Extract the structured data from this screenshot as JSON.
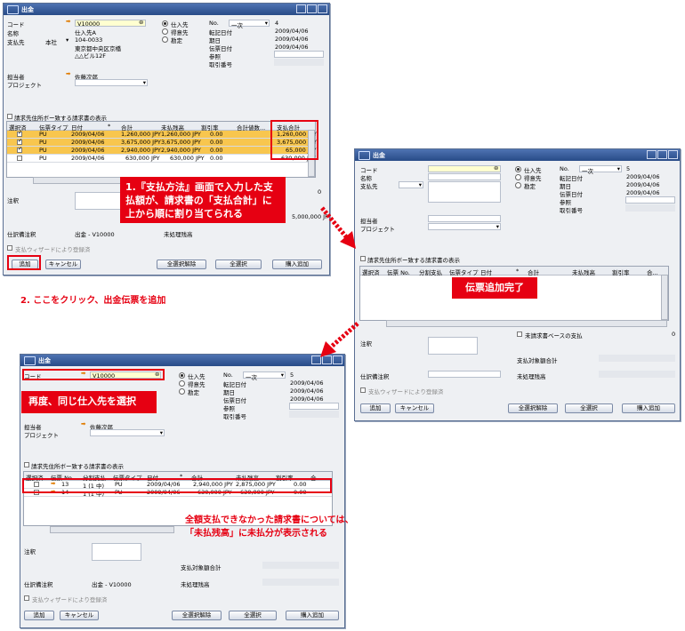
{
  "window_title": "出金",
  "header": {
    "code_label": "コード",
    "name_label": "名称",
    "payee_label": "支払先",
    "payee_sel": "本社",
    "contact_label": "担当者",
    "project_label": "プロジェクト",
    "code_value": "V10000",
    "name_value": "仕入先A",
    "addr1": "104-0033",
    "addr2": "東京都中央区京橋",
    "addr3": "△△ビル12F",
    "contact_value": "佐藤次郎"
  },
  "radio": {
    "vendor": "仕入先",
    "customer": "得意先",
    "account": "勘定"
  },
  "right": {
    "no_label": "No.",
    "no_series": "一次",
    "no1": "4",
    "no3": "5",
    "posting_date_label": "転記日付",
    "due_date_label": "期日",
    "doc_date_label": "伝票日付",
    "reference_label": "参照",
    "trans_no_label": "取引番号",
    "date_value": "2009/04/06"
  },
  "grid_section": {
    "checkbox_label": "請求先住所ボー致する請求書の表示"
  },
  "grid1": {
    "columns": [
      "選択済",
      "伝票タイプ",
      "日付",
      "*",
      "合計",
      "未払残高",
      "割引率",
      "合計値数...",
      "支払合計"
    ],
    "rows": [
      {
        "type": "PU",
        "date": "2009/04/06",
        "total": "1,260,000 JPY",
        "balance": "1,260,000 JPY",
        "disc": "0.00",
        "pay": "1,260,000 JPY"
      },
      {
        "type": "PU",
        "date": "2009/04/06",
        "total": "3,675,000 JPY",
        "balance": "3,675,000 JPY",
        "disc": "0.00",
        "pay": "3,675,000 JPY"
      },
      {
        "type": "PU",
        "date": "2009/04/06",
        "total": "2,940,000 JPY",
        "balance": "2,940,000 JPY",
        "disc": "0.00",
        "pay": "65,000 JPY"
      },
      {
        "type": "PU",
        "date": "2009/04/06",
        "total": "630,000 JPY",
        "balance": "630,000 JPY",
        "disc": "0.00",
        "pay": "630,000 JPY"
      }
    ]
  },
  "grid2_columns": [
    "選択済",
    "伝票 No.",
    "分割支払",
    "伝票タイプ",
    "日付",
    "*",
    "合計",
    "未払残高",
    "割引率",
    "合..."
  ],
  "grid3": {
    "columns": [
      "選択済",
      "伝票 No.",
      "分割支払",
      "伝票タイプ",
      "日付",
      "*",
      "合計",
      "未払残高",
      "割引率",
      "合..."
    ],
    "rows": [
      {
        "no": "13",
        "split": "1 (1 中)",
        "type": "PU",
        "date": "2009/04/06",
        "total": "2,940,000 JPY",
        "balance": "2,875,000 JPY",
        "disc": "0.00"
      },
      {
        "no": "14",
        "split": "1 (1 中)",
        "type": "PU",
        "date": "2009/04/06",
        "total": "630,000 JPY",
        "balance": "630,000 JPY",
        "disc": "0.00"
      }
    ]
  },
  "bottom": {
    "remarks_label": "注釈",
    "journal_label": "仕訳備注釈",
    "journal_value": "出金 - V10000",
    "payable_total_label": "支払対象額合計",
    "unassigned_label": "未処理残高",
    "pay_wizard_label": "支払ウィザードにより登録済",
    "amount_value": "5,000,000 JPY",
    "zero_value": "0",
    "base_invoice_label": "未請求書ベースの支払"
  },
  "buttons": {
    "add": "追加",
    "cancel": "キャンセル",
    "deselect_all": "全選択解除",
    "select_all": "全選択",
    "payment_means": "購入追加"
  },
  "annotations": {
    "note1_line1": "1.『支払方法』画面で入力した支",
    "note1_line2": "払額が、請求書の「支払合計」に",
    "note1_line3": "上から順に割り当てられる",
    "note2": "2. ここをクリック、出金伝票を追加",
    "note3": "伝票追加完了",
    "note4": "再度、同じ仕入先を選択",
    "note5_line1": "全額支払できなかった請求書については、",
    "note5_line2": "「未払残高」に未払分が表示される"
  },
  "colors": {
    "accent_red": "#e60012",
    "title_blue": "#284b87",
    "row_highlight": "#f8c64e"
  }
}
